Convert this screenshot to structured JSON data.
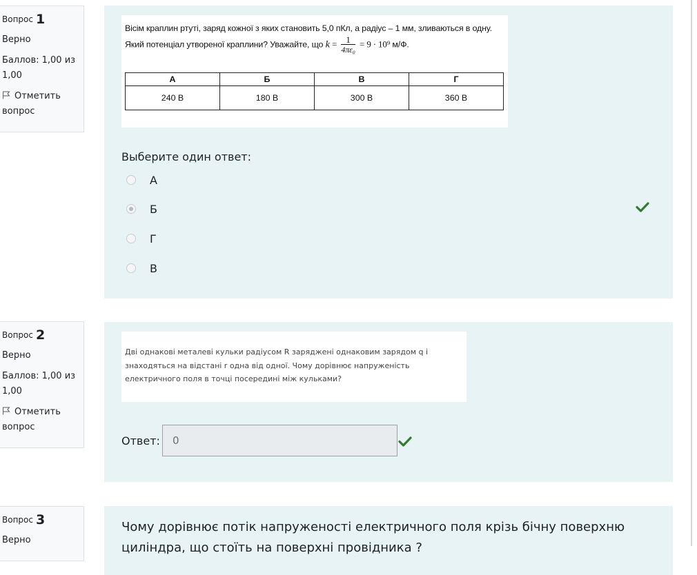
{
  "questions": [
    {
      "label": "Вопрос",
      "number": "1",
      "state": "Верно",
      "grade": "Баллов: 1,00 из 1,00",
      "flag": "Отметить вопрос",
      "text_part1": "Вісім краплин ртуті, заряд кожної з яких становить 5,0 пКл, а радіус – 1 мм, зливаються в одну. Який потенціал утвореної краплини? Уважайте, що",
      "formula": {
        "k": "k",
        "eq": "=",
        "numerator": "1",
        "denominator": "4πε₀",
        "rhs": "= 9 · 10⁹",
        "unit": "м/Ф."
      },
      "table_headers": [
        "А",
        "Б",
        "В",
        "Г"
      ],
      "table_values": [
        "240 В",
        "180 В",
        "300 В",
        "360 В"
      ],
      "prompt": "Выберите один ответ:",
      "options": [
        {
          "label": "А",
          "selected": false
        },
        {
          "label": "Б",
          "selected": true
        },
        {
          "label": "Г",
          "selected": false
        },
        {
          "label": "В",
          "selected": false
        }
      ]
    },
    {
      "label": "Вопрос",
      "number": "2",
      "state": "Верно",
      "grade": "Баллов: 1,00 из 1,00",
      "flag": "Отметить вопрос",
      "text": "Дві однакові металеві кульки радіусом R заряджені однаковим зарядом q і знаходяться на відстані r одна від одної. Чому дорівнює напруженість електричного поля в точці посередині між кульками?",
      "answer_label": "Ответ:",
      "answer_value": "0"
    },
    {
      "label": "Вопрос",
      "number": "3",
      "state": "Верно",
      "text": "Чому дорівнює потік напруженості електричного  поля крізь бічну поверхню циліндра, що стоїть на поверхні провідника ?"
    }
  ],
  "colors": {
    "panel_bg": "#e7f3f5",
    "info_bg": "#f8f9fa",
    "correct": "#357a32"
  },
  "icons": [
    "flag-icon",
    "check-icon"
  ]
}
